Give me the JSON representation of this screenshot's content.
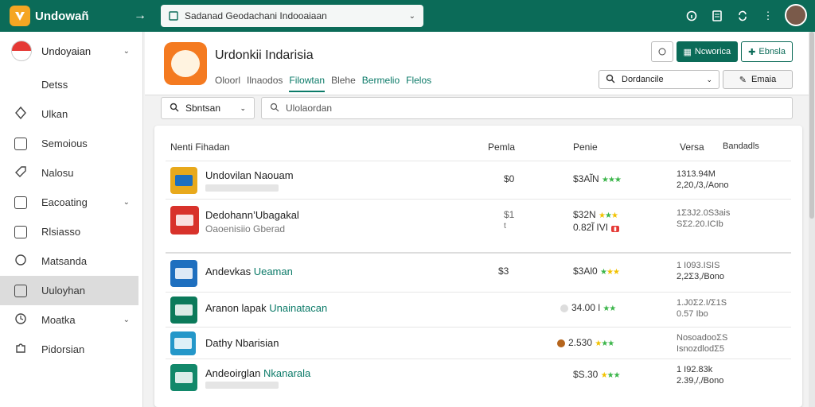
{
  "topbar": {
    "brand": "Undowañ",
    "search_text": "Sadanad Geodachani Indooaiaan",
    "icons": [
      "info-icon",
      "document-icon",
      "sync-icon",
      "more-icon"
    ]
  },
  "sidebar": {
    "header_label": "Undoyaian",
    "items": [
      {
        "label": "Detss",
        "icon": "none"
      },
      {
        "label": "Ulkan",
        "icon": "diamond-icon"
      },
      {
        "label": "Semoious",
        "icon": "window-icon"
      },
      {
        "label": "Nalosu",
        "icon": "tag-icon"
      },
      {
        "label": "Eacoating",
        "icon": "calendar-icon",
        "chevron": true
      },
      {
        "label": "Rlsiasso",
        "icon": "box-icon"
      },
      {
        "label": "Matsanda",
        "icon": "settings-icon"
      },
      {
        "label": "Uuloyhan",
        "icon": "folder-icon",
        "active": true
      },
      {
        "label": "Moatka",
        "icon": "clock-icon",
        "chevron": true
      },
      {
        "label": "Pidorsian",
        "icon": "puzzle-icon"
      }
    ]
  },
  "header": {
    "app_title": "Urdonkii Indarisia",
    "tabs": [
      "Oloorl",
      "Ilnaodos",
      "Filowtan",
      "Blehe",
      "Bermelio",
      "Flelos"
    ],
    "active_tab": 2,
    "btn_info": "",
    "btn_primary": "Ncworica",
    "btn_outline": "Ebnsla",
    "select_value": "Dordancile",
    "edit_label": "Emaia"
  },
  "filters": {
    "select_value": "Sbntsan",
    "search_placeholder": "Ulolaordan"
  },
  "table": {
    "columns": [
      "Nenti Fihadan",
      "Pemla",
      "Penie",
      "Versa",
      "Bandadls"
    ],
    "rows": [
      {
        "name": "Undovilan Naouam",
        "name_hl": "",
        "sub": "",
        "p1": "$0",
        "p2": "$3Al̃N",
        "v1": "1313.94M",
        "v2": "2,20,/3,/Aono",
        "color": "#e8a91c"
      },
      {
        "name": "Dedohann’Ubagakal",
        "name_hl": "",
        "sub": "Oaoenisiio Gberad",
        "p1": "$1",
        "p1b": "t",
        "p2": "$32N",
        "p2b": "0.82l̃ IVI",
        "v1": "1Σ3J2.0S3ais",
        "v2": "SΣ2.20.ICIb",
        "color": "#d8322b"
      },
      {
        "name": "Andevkas ",
        "name_hl": "Ueaman",
        "sub": "",
        "p1": "$3",
        "p2": "$3Al0",
        "v1": "1 I093.ISIS",
        "v2": "2,2Σ3,/Bono",
        "color": "#1e6fbf"
      },
      {
        "name": "Aranon lapak ",
        "name_hl": "Unainatacan",
        "sub": "",
        "p1": "",
        "p2": "34.00 l",
        "v1": "1.J0Σ2.I/Σ1S",
        "v2": "0.57 Ibo",
        "color": "#0b7a5a"
      },
      {
        "name": "Dathy Nbarisian",
        "name_hl": "",
        "sub": "",
        "p1": "",
        "p2": "2.530",
        "v1": "NosoadooΣS",
        "v2": "IsnozdlodΣ5",
        "color": "#2497c9"
      },
      {
        "name": "Andeoirglan ",
        "name_hl": "Nkanarala",
        "sub": "",
        "p1": "",
        "p2": "$S.30",
        "v1": "1 I92.83k",
        "v2": "2.39,/,/Bono",
        "color": "#12886a"
      }
    ]
  }
}
